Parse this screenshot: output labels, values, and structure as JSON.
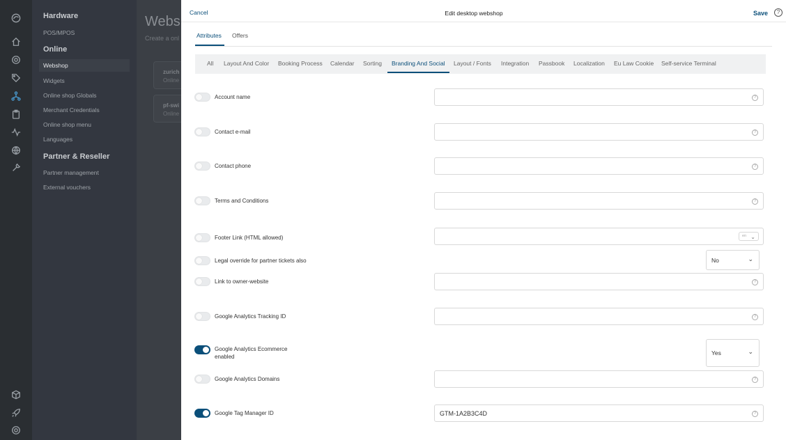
{
  "nav": {
    "sections": [
      {
        "title": "Hardware",
        "items": [
          "POS/MPOS"
        ]
      },
      {
        "title": "Online",
        "items": [
          "Webshop",
          "Widgets",
          "Online shop Globals",
          "Merchant Credentials",
          "Online shop menu",
          "Languages"
        ]
      },
      {
        "title": "Partner & Reseller",
        "items": [
          "Partner management",
          "External vouchers"
        ]
      }
    ],
    "active_item": "Webshop"
  },
  "rail_icons": [
    "logo-icon",
    "home-icon",
    "settings-icon",
    "tag-icon",
    "network-icon",
    "clipboard-icon",
    "activity-icon",
    "globe-icon",
    "tools-icon",
    "box-icon",
    "rocket-icon",
    "support-icon"
  ],
  "main": {
    "title": "Websh",
    "subtitle": "Create a onl",
    "cards": [
      {
        "name": "zurich",
        "type": "Online"
      },
      {
        "name": "pf-swi",
        "type": "Online"
      }
    ]
  },
  "modal": {
    "cancel_label": "Cancel",
    "title": "Edit desktop webshop",
    "save_label": "Save",
    "help_glyph": "?",
    "tabs": [
      "Attributes",
      "Offers"
    ],
    "active_tab": "Attributes",
    "subtabs": [
      "All",
      "Layout And Color",
      "Booking Process",
      "Calendar",
      "Sorting",
      "Branding And Social",
      "Layout / Fonts",
      "Integration",
      "Passbook",
      "Localization",
      "Eu Law Cookie",
      "Self-service Terminal"
    ],
    "active_subtab": "Branding And Social",
    "fields": [
      {
        "label": "Account name",
        "toggle": false,
        "kind": "text",
        "value": ""
      },
      {
        "label": "Contact e-mail",
        "toggle": false,
        "kind": "text",
        "value": ""
      },
      {
        "label": "Contact phone",
        "toggle": false,
        "kind": "text",
        "value": ""
      },
      {
        "label": "Terms and Conditions",
        "toggle": false,
        "kind": "text",
        "value": ""
      },
      {
        "label": "Footer Link (HTML allowed)",
        "toggle": false,
        "kind": "text-lang",
        "value": "",
        "lang": "en"
      },
      {
        "label": "Legal override for partner tickets also",
        "toggle": false,
        "kind": "select",
        "value": "No"
      },
      {
        "label": "Link to owner-website",
        "toggle": false,
        "kind": "text",
        "value": ""
      },
      {
        "label": "Google Analytics Tracking ID",
        "toggle": false,
        "kind": "text",
        "value": ""
      },
      {
        "label": "Google Analytics Ecommerce enabled",
        "toggle": true,
        "kind": "select",
        "value": "Yes"
      },
      {
        "label": "Google Analytics Domains",
        "toggle": false,
        "kind": "text",
        "value": ""
      },
      {
        "label": "Google Tag Manager ID",
        "toggle": true,
        "kind": "text",
        "value": "GTM-1A2B3C4D"
      }
    ]
  },
  "colors": {
    "accent": "#0b4f7a",
    "rail_bg": "#2a2e32",
    "nav_bg": "#333740"
  }
}
